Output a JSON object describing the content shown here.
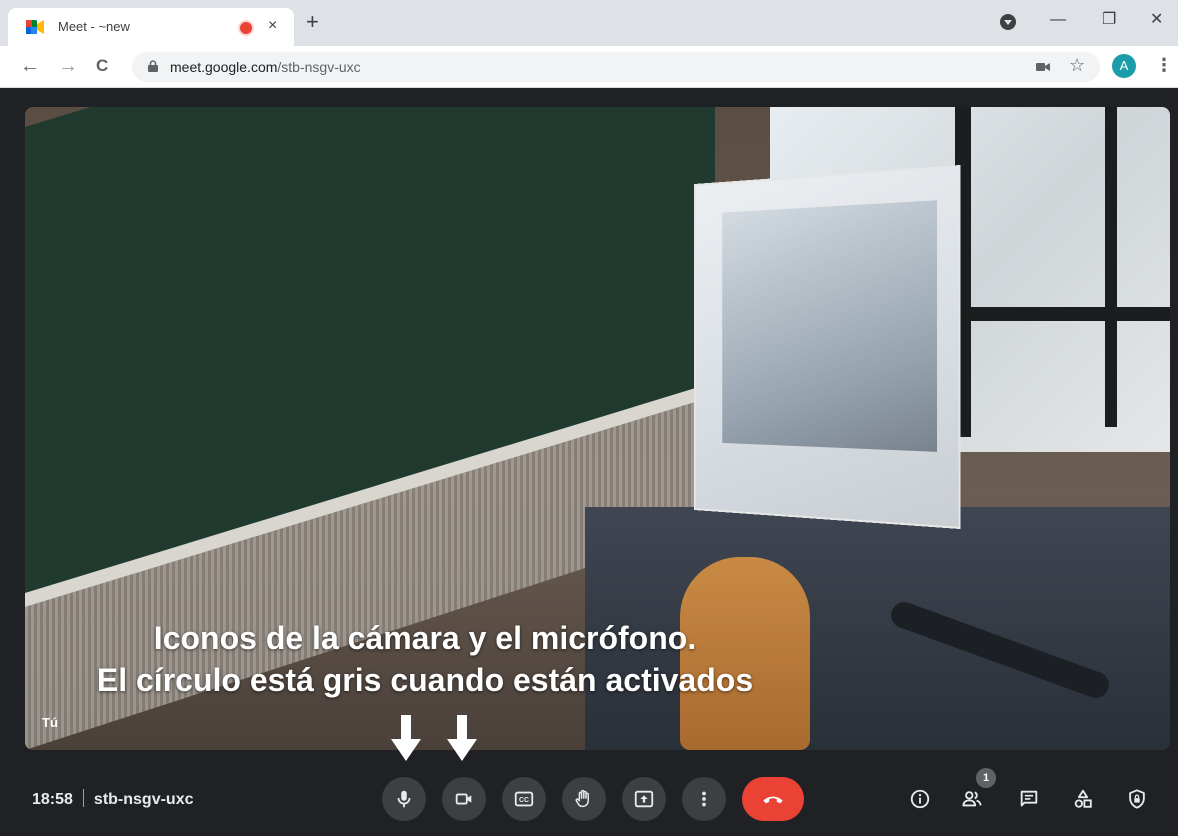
{
  "browser": {
    "tab_title": "Meet - ~new",
    "tab_close": "×",
    "new_tab": "+",
    "minimize": "—",
    "restore": "❐",
    "close": "✕",
    "back": "←",
    "forward": "→",
    "reload": "C",
    "url_host": "meet.google.com",
    "url_path": "/stb-nsgv-uxc",
    "star": "☆",
    "profile_initial": "A",
    "menu": "⋮"
  },
  "video": {
    "caption_line1": "Iconos de la cámara y el micrófono.",
    "caption_line2": "El círculo está gris cuando están activados",
    "self_label": "Tú"
  },
  "meeting": {
    "time": "18:58",
    "code": "stb-nsgv-uxc",
    "participants_count": "1"
  },
  "colors": {
    "hangup": "#ea4335",
    "control_bg": "#3c4043",
    "background": "#202124",
    "avatar": "#1a9da8"
  }
}
